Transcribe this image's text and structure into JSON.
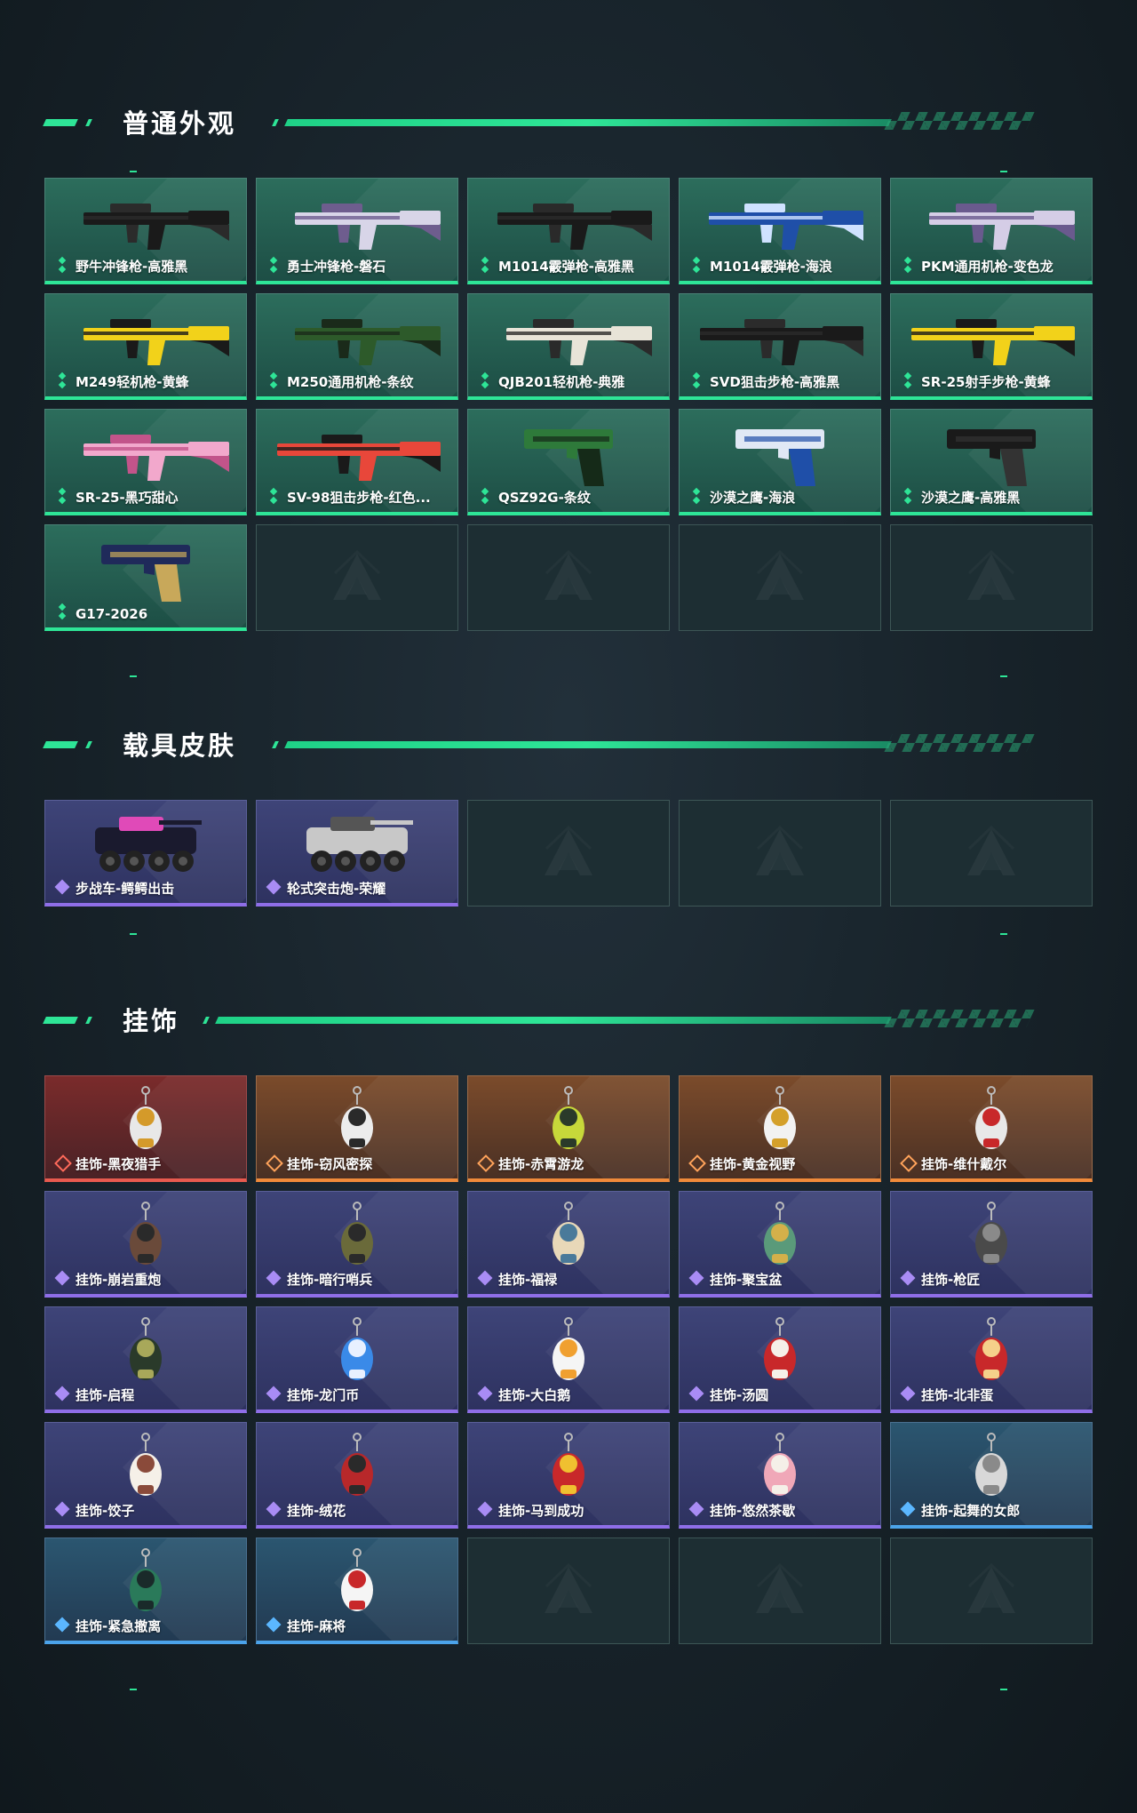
{
  "sections": [
    {
      "title": "普通外观",
      "items": [
        {
          "label": "野牛冲锋枪-高雅黑",
          "rarity": "green",
          "kind": "smg",
          "colors": [
            "#1a1a1a",
            "#2b2b2b"
          ]
        },
        {
          "label": "勇士冲锋枪-磐石",
          "rarity": "green",
          "kind": "smg",
          "colors": [
            "#d8d5e8",
            "#6e5d8e"
          ]
        },
        {
          "label": "M1014霰弹枪-高雅黑",
          "rarity": "green",
          "kind": "shotgun",
          "colors": [
            "#1a1a1a",
            "#2a2a2a"
          ]
        },
        {
          "label": "M1014霰弹枪-海浪",
          "rarity": "green",
          "kind": "shotgun",
          "colors": [
            "#1f4fa8",
            "#cfe2ff"
          ]
        },
        {
          "label": "PKM通用机枪-变色龙",
          "rarity": "green",
          "kind": "mg",
          "colors": [
            "#d5cde6",
            "#6a5a8e"
          ]
        },
        {
          "label": "M249轻机枪-黄蜂",
          "rarity": "green",
          "kind": "mg",
          "colors": [
            "#f2d21a",
            "#1a1a1a"
          ]
        },
        {
          "label": "M250通用机枪-条纹",
          "rarity": "green",
          "kind": "mg",
          "colors": [
            "#2d5a2a",
            "#1a2a1a"
          ]
        },
        {
          "label": "QJB201轻机枪-典雅",
          "rarity": "green",
          "kind": "mg",
          "colors": [
            "#e8e4d8",
            "#2a2a2a"
          ]
        },
        {
          "label": "SVD狙击步枪-高雅黑",
          "rarity": "green",
          "kind": "sniper",
          "colors": [
            "#1a1a1a",
            "#2b2b2b"
          ]
        },
        {
          "label": "SR-25射手步枪-黄蜂",
          "rarity": "green",
          "kind": "sniper",
          "colors": [
            "#f2d21a",
            "#1a1a1a"
          ]
        },
        {
          "label": "SR-25-黑巧甜心",
          "rarity": "green",
          "kind": "rifle",
          "colors": [
            "#f2a8cc",
            "#c2548a"
          ]
        },
        {
          "label": "SV-98狙击步枪-红色...",
          "rarity": "green",
          "kind": "sniper",
          "colors": [
            "#e8473a",
            "#1a1a1a"
          ]
        },
        {
          "label": "QSZ92G-条纹",
          "rarity": "green",
          "kind": "pistol",
          "colors": [
            "#2e7a3a",
            "#152a18"
          ]
        },
        {
          "label": "沙漠之鹰-海浪",
          "rarity": "green",
          "kind": "pistol",
          "colors": [
            "#e0e8f5",
            "#1f4fa8"
          ]
        },
        {
          "label": "沙漠之鹰-高雅黑",
          "rarity": "green",
          "kind": "pistol",
          "colors": [
            "#1a1a1a",
            "#333333"
          ]
        },
        {
          "label": "G17-2026",
          "rarity": "green",
          "kind": "pistol",
          "colors": [
            "#1f2a5a",
            "#c8a85a"
          ]
        },
        {
          "label": "",
          "rarity": "empty"
        },
        {
          "label": "",
          "rarity": "empty"
        },
        {
          "label": "",
          "rarity": "empty"
        },
        {
          "label": "",
          "rarity": "empty"
        }
      ]
    },
    {
      "title": "载具皮肤",
      "items": [
        {
          "label": "步战车-鳄鳄出击",
          "rarity": "purple",
          "kind": "vehicle",
          "colors": [
            "#1a1a2e",
            "#e04ab8"
          ]
        },
        {
          "label": "轮式突击炮-荣耀",
          "rarity": "purple",
          "kind": "vehicle",
          "colors": [
            "#c8c8c8",
            "#555555"
          ]
        },
        {
          "label": "",
          "rarity": "empty"
        },
        {
          "label": "",
          "rarity": "empty"
        },
        {
          "label": "",
          "rarity": "empty"
        }
      ]
    },
    {
      "title": "挂饰",
      "items": [
        {
          "label": "挂饰-黑夜猎手",
          "rarity": "red",
          "kind": "charm",
          "colors": [
            "#e8e8e8",
            "#d49a2a"
          ]
        },
        {
          "label": "挂饰-窃风密探",
          "rarity": "orange",
          "kind": "charm",
          "colors": [
            "#ececec",
            "#2a2a2a"
          ]
        },
        {
          "label": "挂饰-赤霄游龙",
          "rarity": "orange",
          "kind": "charm",
          "colors": [
            "#c7d83a",
            "#2a3a2a"
          ]
        },
        {
          "label": "挂饰-黄金视野",
          "rarity": "orange",
          "kind": "charm",
          "colors": [
            "#f2f2f2",
            "#d4a02a"
          ]
        },
        {
          "label": "挂饰-维什戴尔",
          "rarity": "orange",
          "kind": "charm",
          "colors": [
            "#e8e8e8",
            "#c8282a"
          ]
        },
        {
          "label": "挂饰-崩岩重炮",
          "rarity": "purple",
          "kind": "charm",
          "colors": [
            "#6a4a3a",
            "#2a2a2a"
          ]
        },
        {
          "label": "挂饰-暗行哨兵",
          "rarity": "purple",
          "kind": "charm",
          "colors": [
            "#6a6a3a",
            "#2a2a2a"
          ]
        },
        {
          "label": "挂饰-福禄",
          "rarity": "purple",
          "kind": "charm",
          "colors": [
            "#e8d8b8",
            "#4a7a9a"
          ]
        },
        {
          "label": "挂饰-聚宝盆",
          "rarity": "purple",
          "kind": "charm",
          "colors": [
            "#5a9a7a",
            "#d4b04a"
          ]
        },
        {
          "label": "挂饰-枪匠",
          "rarity": "purple",
          "kind": "charm",
          "colors": [
            "#4a4a4a",
            "#8a8a8a"
          ]
        },
        {
          "label": "挂饰-启程",
          "rarity": "purple",
          "kind": "charm",
          "colors": [
            "#2a3a2a",
            "#a8a85a"
          ]
        },
        {
          "label": "挂饰-龙门币",
          "rarity": "purple",
          "kind": "charm",
          "colors": [
            "#3a8ae8",
            "#e8f0ff"
          ]
        },
        {
          "label": "挂饰-大白鹅",
          "rarity": "purple",
          "kind": "charm",
          "colors": [
            "#f5f5f5",
            "#f0a030"
          ]
        },
        {
          "label": "挂饰-汤圆",
          "rarity": "purple",
          "kind": "charm",
          "colors": [
            "#c8282a",
            "#f5f0e8"
          ]
        },
        {
          "label": "挂饰-北非蛋",
          "rarity": "purple",
          "kind": "charm",
          "colors": [
            "#c8282a",
            "#f5d08a"
          ]
        },
        {
          "label": "挂饰-饺子",
          "rarity": "purple",
          "kind": "charm",
          "colors": [
            "#f5f0e8",
            "#8a4a3a"
          ]
        },
        {
          "label": "挂饰-绒花",
          "rarity": "purple",
          "kind": "charm",
          "colors": [
            "#b8282a",
            "#2a2a2a"
          ]
        },
        {
          "label": "挂饰-马到成功",
          "rarity": "purple",
          "kind": "charm",
          "colors": [
            "#c8282a",
            "#f0c030"
          ]
        },
        {
          "label": "挂饰-悠然茶歇",
          "rarity": "purple",
          "kind": "charm",
          "colors": [
            "#f0a8b8",
            "#f5f0e8"
          ]
        },
        {
          "label": "挂饰-起舞的女郎",
          "rarity": "blue",
          "kind": "charm",
          "colors": [
            "#d8d8d8",
            "#8a8a8a"
          ]
        },
        {
          "label": "挂饰-紧急撤离",
          "rarity": "blue",
          "kind": "charm",
          "colors": [
            "#2a7a5a",
            "#1a2a2a"
          ]
        },
        {
          "label": "挂饰-麻将",
          "rarity": "blue",
          "kind": "charm",
          "colors": [
            "#f5f5f5",
            "#c8282a"
          ]
        },
        {
          "label": "",
          "rarity": "empty"
        },
        {
          "label": "",
          "rarity": "empty"
        },
        {
          "label": "",
          "rarity": "empty"
        }
      ]
    }
  ]
}
